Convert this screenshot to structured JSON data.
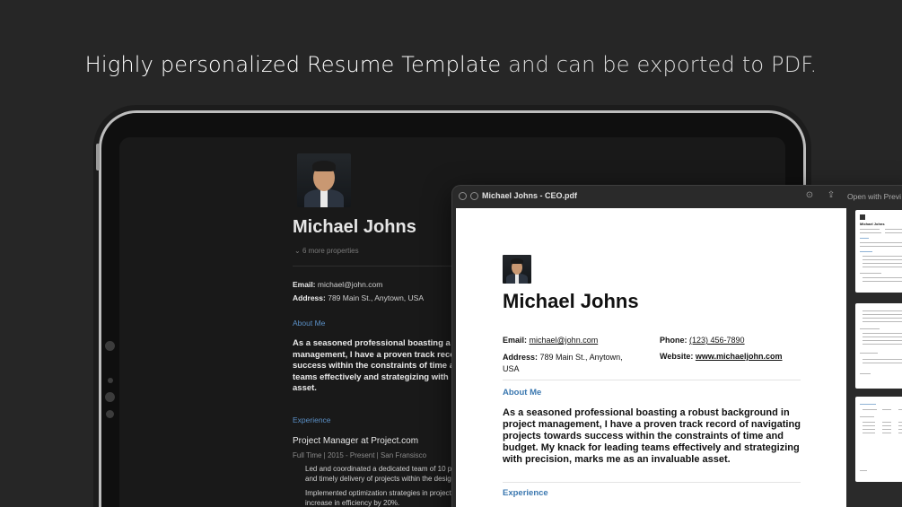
{
  "headline": {
    "strong": "Highly personalized Resume Template",
    "rest": " and can be exported to PDF."
  },
  "notion": {
    "name": "Michael Johns",
    "more_properties": "6 more properties",
    "email_label": "Email:",
    "email": "michael@john.com",
    "address_label": "Address:",
    "address": "789 Main St., Anytown, USA",
    "about_heading": "About Me",
    "about_lines": [
      "As a seasoned professional boasting a ro",
      "management, I have a proven track recor",
      "success within the constraints of time ar",
      "teams effectively and strategizing with p",
      "asset."
    ],
    "experience_heading": "Experience",
    "job_title": "Project Manager at Project.com",
    "job_meta": "Full Time | 2015 - Present | San Fransisco",
    "bullets": [
      [
        "Led and coordinated a dedicated team of 10 pr",
        "and timely delivery of projects within the desig"
      ],
      [
        "Implemented optimization strategies in project",
        "increase in efficiency by 20%."
      ]
    ]
  },
  "pdf": {
    "title": "Michael Johns - CEO.pdf",
    "open_with": "Open with Previ",
    "name": "Michael Johns",
    "email_label": "Email:",
    "email": "michael@john.com",
    "phone_label": "Phone:",
    "phone": "(123) 456-7890",
    "address_label": "Address:",
    "address_line1": "789 Main St., Anytown,",
    "address_line2": "USA",
    "website_label": "Website:",
    "website": "www.michaeljohn.com",
    "about_heading": "About Me",
    "about_lines": [
      "As a seasoned professional boasting a robust background in",
      "project management, I have a proven track record of navigating",
      "projects towards success within the constraints of time and",
      "budget. My knack for leading teams effectively and strategizing",
      "with precision, marks me as an invaluable asset."
    ],
    "experience_heading": "Experience",
    "thumb_name": "Michael Johns"
  },
  "colors": {
    "background": "#262626",
    "accent_blue_dark": "#5a8fc5",
    "accent_blue_pdf": "#3b78b0"
  },
  "icons": [
    "close-icon",
    "block-icon",
    "markup-icon",
    "share-icon",
    "chevron-down-icon"
  ]
}
